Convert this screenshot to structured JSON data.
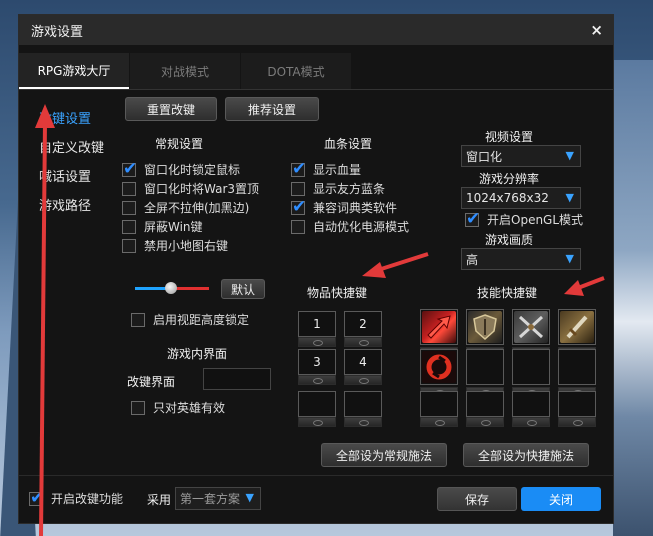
{
  "window": {
    "title": "游戏设置",
    "close_glyph": "×"
  },
  "tabs": [
    "RPG游戏大厅",
    "对战模式",
    "DOTA模式"
  ],
  "sidebar": {
    "items": [
      "改键设置",
      "自定义改键",
      "喊话设置",
      "游戏路径"
    ],
    "active_index": 0
  },
  "toolbar": {
    "reset_label": "重置改键",
    "recommend_label": "推荐设置"
  },
  "general": {
    "title": "常规设置",
    "options": [
      {
        "label": "窗口化时锁定鼠标",
        "checked": true
      },
      {
        "label": "窗口化时将War3置顶",
        "checked": false
      },
      {
        "label": "全屏不拉伸(加黑边)",
        "checked": false
      },
      {
        "label": "屏蔽Win键",
        "checked": false
      },
      {
        "label": "禁用小地图右键",
        "checked": false
      }
    ]
  },
  "healthbar": {
    "title": "血条设置",
    "options": [
      {
        "label": "显示血量",
        "checked": true
      },
      {
        "label": "显示友方蓝条",
        "checked": false
      },
      {
        "label": "兼容词典类软件",
        "checked": true
      },
      {
        "label": "自动优化电源模式",
        "checked": false
      }
    ]
  },
  "video": {
    "title": "视频设置",
    "mode_value": "窗口化",
    "resolution_title": "游戏分辨率",
    "resolution_value": "1024x768x32",
    "opengl_label": "开启OpenGL模式",
    "opengl_checked": true,
    "quality_title": "游戏画质",
    "quality_value": "高"
  },
  "view": {
    "default_label": "默认",
    "lock_label": "启用视距高度锁定",
    "lock_checked": false,
    "slider_level": 0.47
  },
  "ingame": {
    "title": "游戏内界面",
    "remap_label": "改键界面",
    "remap_value": "",
    "hero_only_label": "只对英雄有效",
    "hero_only_checked": false
  },
  "items": {
    "title": "物品快捷键",
    "slots": [
      "1",
      "2",
      "3",
      "4",
      "",
      ""
    ]
  },
  "skills": {
    "title": "技能快捷键",
    "slots": [
      {
        "icon": "red-arrow-skill-icon"
      },
      {
        "icon": "shield-skill-icon"
      },
      {
        "icon": "crossed-swords-skill-icon"
      },
      {
        "icon": "sword-skill-icon"
      },
      {
        "icon": "red-swirl-skill-icon"
      },
      {
        "icon": ""
      },
      {
        "icon": ""
      },
      {
        "icon": ""
      },
      {
        "icon": ""
      },
      {
        "icon": ""
      },
      {
        "icon": ""
      },
      {
        "icon": ""
      }
    ]
  },
  "actions": {
    "set_normal_label": "全部设为常规施法",
    "set_quick_label": "全部设为快捷施法"
  },
  "footer": {
    "enable_label": "开启改键功能",
    "enable_checked": true,
    "scheme_label": "采用",
    "scheme_value": "第一套方案",
    "save_label": "保存",
    "close_label": "关闭"
  },
  "colors": {
    "accent": "#1a8cf5",
    "active_text": "#3aa3ff",
    "annotation_arrow": "#e23a3a",
    "slider_left": "#1fa3ff",
    "slider_right": "#e03030"
  }
}
